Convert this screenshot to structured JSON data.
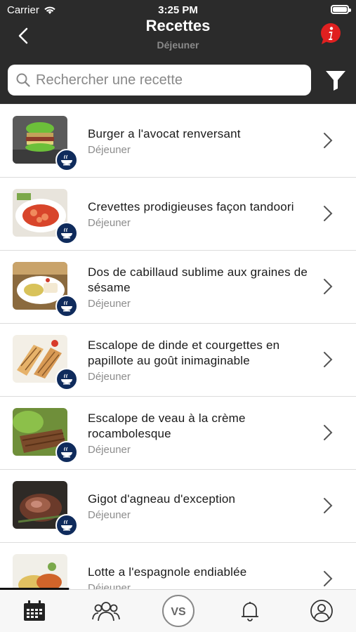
{
  "status": {
    "carrier": "Carrier",
    "time": "3:25 PM"
  },
  "nav": {
    "title": "Recettes",
    "subtitle": "Déjeuner"
  },
  "search": {
    "placeholder": "Rechercher une recette"
  },
  "recipes": [
    {
      "name": "Burger a l'avocat renversant",
      "category": "Déjeuner"
    },
    {
      "name": "Crevettes prodigieuses façon tandoori",
      "category": "Déjeuner"
    },
    {
      "name": "Dos de cabillaud sublime aux graines de sésame",
      "category": "Déjeuner"
    },
    {
      "name": "Escalope de dinde et courgettes en papillote au goût inimaginable",
      "category": "Déjeuner"
    },
    {
      "name": "Escalope de veau à la crème rocambolesque",
      "category": "Déjeuner"
    },
    {
      "name": "Gigot d'agneau d'exception",
      "category": "Déjeuner"
    },
    {
      "name": "Lotte a l'espagnole endiablée",
      "category": "Déjeuner"
    }
  ],
  "tabbar": {
    "items": [
      "calendar-icon",
      "group-icon",
      "vs-logo-icon",
      "bell-icon",
      "profile-icon"
    ],
    "logo_text": "VS"
  },
  "colors": {
    "header": "#2b2b2b",
    "badge": "#0f2b5c",
    "info": "#e02020"
  }
}
